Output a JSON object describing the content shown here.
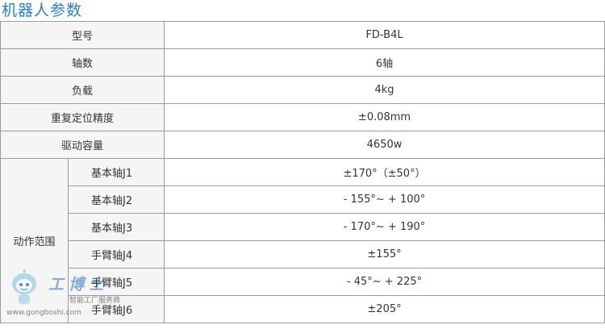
{
  "title": "机器人参数",
  "rows": [
    {
      "label": "型号",
      "value": "FD-B4L"
    },
    {
      "label": "轴数",
      "value": "6轴"
    },
    {
      "label": "负载",
      "value": "4kg"
    },
    {
      "label": "重复定位精度",
      "value": "±0.08mm"
    },
    {
      "label": "驱动容量",
      "value": "4650w"
    }
  ],
  "range": {
    "group_label": "动作范围",
    "items": [
      {
        "label": "基本轴J1",
        "value": "±170°（±50°）"
      },
      {
        "label": "基本轴J2",
        "value": "- 155°~ + 100°"
      },
      {
        "label": "基本轴J3",
        "value": "- 170°~ + 190°"
      },
      {
        "label": "手臂轴J4",
        "value": "±155°"
      },
      {
        "label": "手臂轴J5",
        "value": "- 45°~ + 225°"
      },
      {
        "label": "手臂轴J6",
        "value": "±205°"
      }
    ]
  },
  "watermark": {
    "brand": "工博士",
    "slogan": "智能工厂服务商",
    "url": "www.gongboshi.com"
  }
}
